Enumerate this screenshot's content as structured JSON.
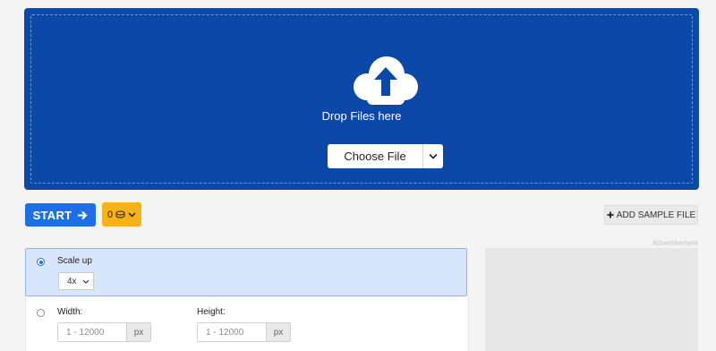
{
  "upload": {
    "drop_text": "Drop Files here",
    "choose_label": "Choose File"
  },
  "toolbar": {
    "start_label": "START",
    "credits_count": "0",
    "sample_label": "ADD SAMPLE FILE"
  },
  "ad": {
    "label": "Advertisement"
  },
  "options": {
    "scale_label": "Scale up",
    "scale_value": "4x",
    "scale_selected": true,
    "width_label": "Width:",
    "height_label": "Height:",
    "width_placeholder": "1 - 12000",
    "height_placeholder": "1 - 12000",
    "unit": "px"
  },
  "colors": {
    "dropzone": "#0b48a8",
    "start_button": "#1e6fe6",
    "credits_button": "#f7b218",
    "selected_option_bg": "#d8e6fb"
  },
  "icons": {
    "upload": "cloud-upload-icon",
    "caret": "chevron-down-icon",
    "start_arrow": "arrow-right-icon",
    "credits": "coins-icon",
    "sample": "plus-icon"
  }
}
